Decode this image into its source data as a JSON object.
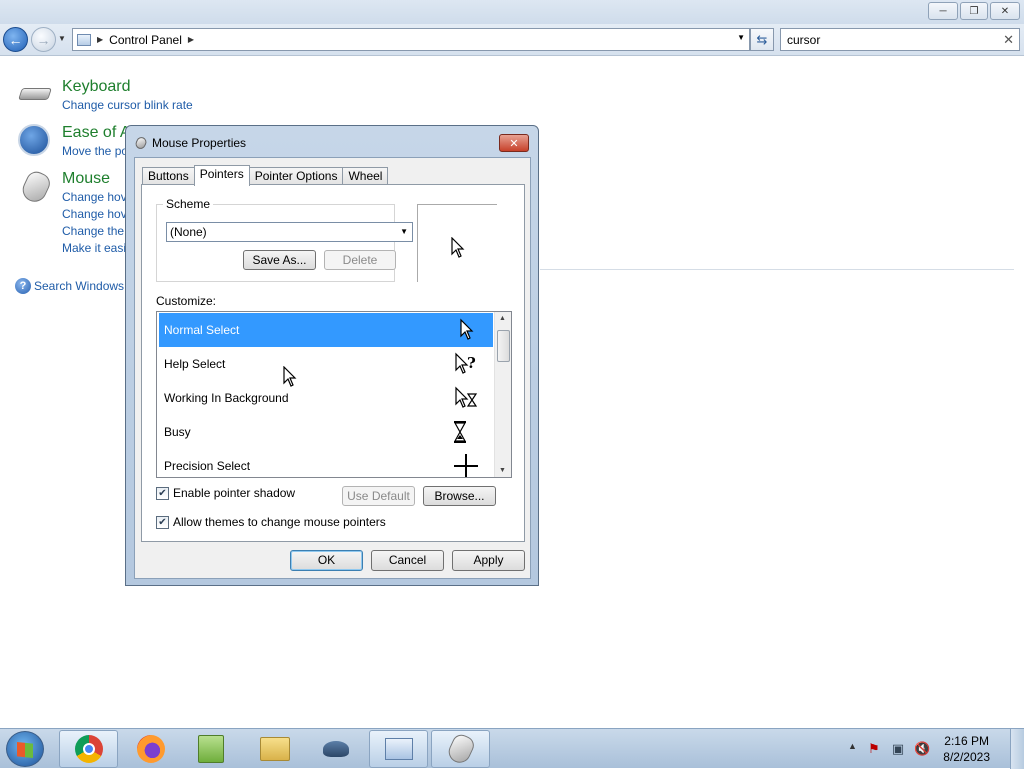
{
  "window": {
    "address": {
      "crumbs": [
        "Control Panel"
      ]
    },
    "search": {
      "value": "cursor",
      "clear_icon": "close-icon"
    }
  },
  "results": [
    {
      "title": "Keyboard",
      "icon": "keyboard-icon",
      "links": [
        "Change cursor blink rate"
      ]
    },
    {
      "title": "Ease of A",
      "icon": "ease-of-access-icon",
      "links": [
        "Move the po"
      ]
    },
    {
      "title": "Mouse",
      "icon": "mouse-icon",
      "links": [
        "Change hov",
        "Change hov",
        "Change the",
        "Make it easi"
      ]
    }
  ],
  "help_link": "Search Windows H",
  "dialog": {
    "title": "Mouse Properties",
    "tabs": [
      {
        "label": "Buttons",
        "active": false
      },
      {
        "label": "Pointers",
        "active": true
      },
      {
        "label": "Pointer Options",
        "active": false
      },
      {
        "label": "Wheel",
        "active": false
      }
    ],
    "scheme": {
      "legend": "Scheme",
      "selected": "(None)",
      "save_as": "Save As...",
      "delete": "Delete"
    },
    "customize_label": "Customize:",
    "cursors": [
      {
        "name": "Normal Select",
        "icon": "arrow-cursor-icon",
        "selected": true
      },
      {
        "name": "Help Select",
        "icon": "help-cursor-icon",
        "selected": false
      },
      {
        "name": "Working In Background",
        "icon": "working-cursor-icon",
        "selected": false
      },
      {
        "name": "Busy",
        "icon": "hourglass-icon",
        "selected": false
      },
      {
        "name": "Precision Select",
        "icon": "crosshair-icon",
        "selected": false
      }
    ],
    "enable_shadow": {
      "label": "Enable pointer shadow",
      "checked": true
    },
    "allow_themes": {
      "label": "Allow themes to change mouse pointers",
      "checked": true
    },
    "use_default": "Use Default",
    "browse": "Browse...",
    "ok": "OK",
    "cancel": "Cancel",
    "apply": "Apply"
  },
  "taskbar": {
    "apps": [
      "chrome-icon",
      "firefox-icon",
      "notepad-plus-plus-icon",
      "file-explorer-icon",
      "network-app-icon",
      "control-panel-icon",
      "mouse-icon"
    ],
    "time": "2:16 PM",
    "date": "8/2/2023"
  },
  "colors": {
    "selection": "#3399ff",
    "link": "#1f5ca8",
    "heading": "#1e7f2d"
  }
}
